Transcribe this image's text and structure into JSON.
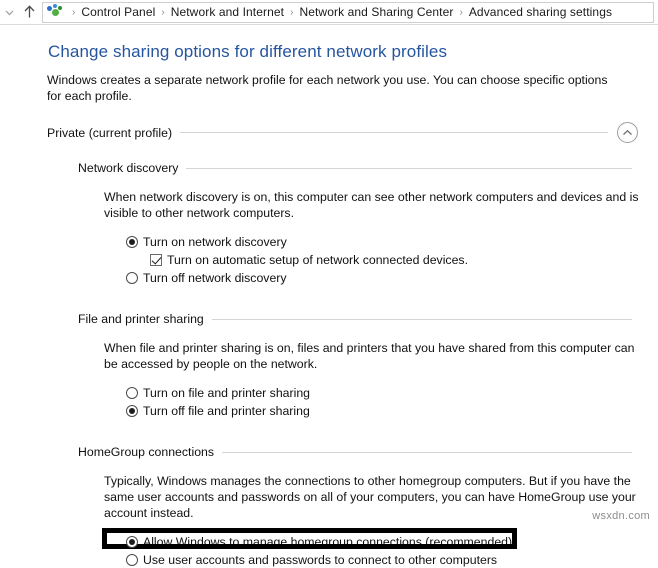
{
  "breadcrumb": {
    "back_chevron_icon": "chevron-down-icon",
    "up_icon": "up-arrow-icon",
    "location_icon": "network-sharing-icon",
    "separator": "›",
    "items": [
      {
        "label": "Control Panel"
      },
      {
        "label": "Network and Internet"
      },
      {
        "label": "Network and Sharing Center"
      },
      {
        "label": "Advanced sharing settings"
      }
    ]
  },
  "page": {
    "title": "Change sharing options for different network profiles",
    "description": "Windows creates a separate network profile for each network you use. You can choose specific options for each profile.",
    "title_color": "#26559f"
  },
  "profile": {
    "label": "Private (current profile)",
    "collapse_icon": "chevron-up-icon",
    "expanded": true
  },
  "sections": [
    {
      "heading": "Network discovery",
      "description": "When network discovery is on, this computer can see other network computers and devices and is visible to other network computers.",
      "options": [
        {
          "type": "radio",
          "label": "Turn on network discovery",
          "selected": true,
          "indent": false
        },
        {
          "type": "checkbox",
          "label": "Turn on automatic setup of network connected devices.",
          "selected": true,
          "indent": true
        },
        {
          "type": "radio",
          "label": "Turn off network discovery",
          "selected": false,
          "indent": false
        }
      ]
    },
    {
      "heading": "File and printer sharing",
      "description": "When file and printer sharing is on, files and printers that you have shared from this computer can be accessed by people on the network.",
      "options": [
        {
          "type": "radio",
          "label": "Turn on file and printer sharing",
          "selected": false,
          "indent": false
        },
        {
          "type": "radio",
          "label": "Turn off file and printer sharing",
          "selected": true,
          "indent": false
        }
      ]
    },
    {
      "heading": "HomeGroup connections",
      "description": "Typically, Windows manages the connections to other homegroup computers. But if you have the same user accounts and passwords on all of your computers, you can have HomeGroup use your account instead.",
      "options": [
        {
          "type": "radio",
          "label": "Allow Windows to manage homegroup connections (recommended)",
          "selected": true,
          "indent": false,
          "highlighted": true
        },
        {
          "type": "radio",
          "label": "Use user accounts and passwords to connect to other computers",
          "selected": false,
          "indent": false
        }
      ]
    }
  ],
  "watermark": {
    "text": "wsxdn.com"
  }
}
